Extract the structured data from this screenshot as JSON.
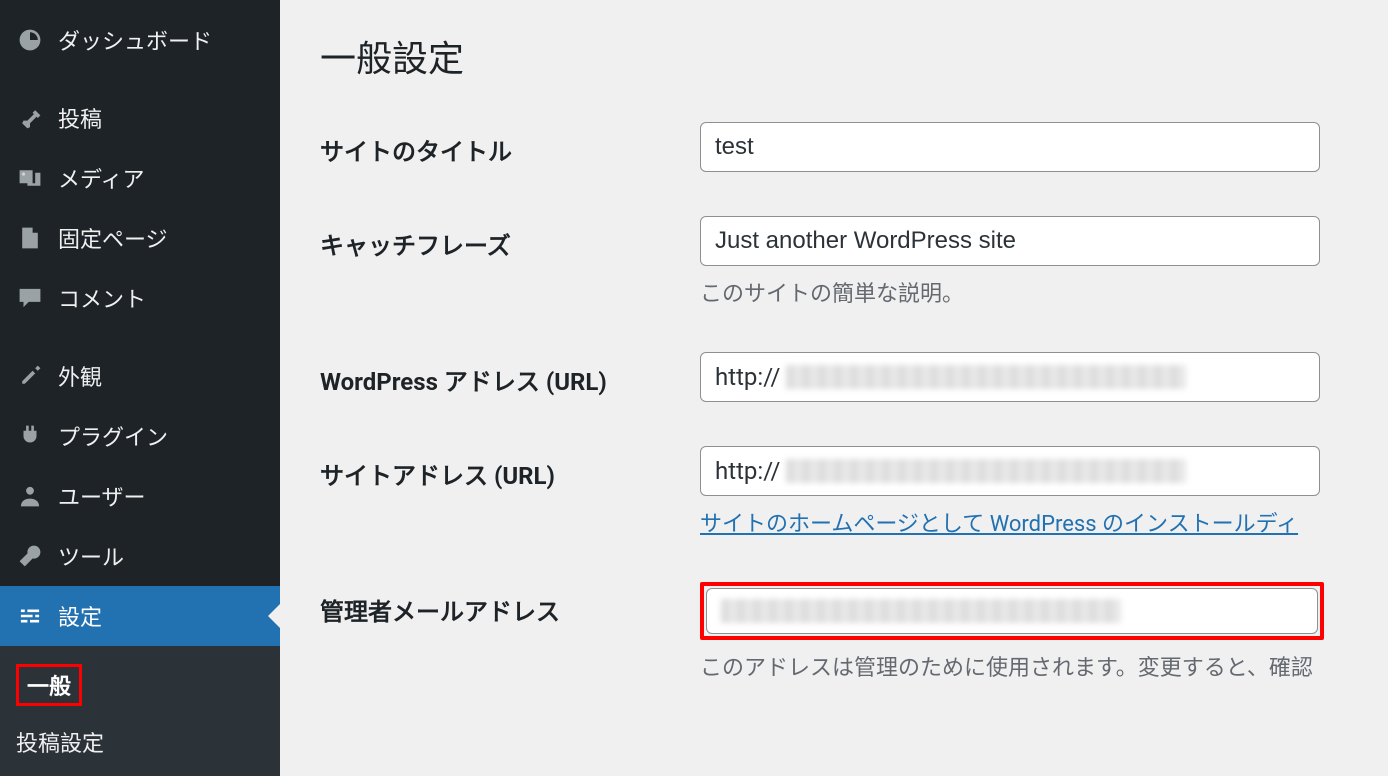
{
  "sidebar": {
    "items": [
      {
        "label": "ダッシュボード",
        "icon": "dashboard"
      },
      {
        "label": "投稿",
        "icon": "pin"
      },
      {
        "label": "メディア",
        "icon": "media"
      },
      {
        "label": "固定ページ",
        "icon": "page"
      },
      {
        "label": "コメント",
        "icon": "comment"
      },
      {
        "label": "外観",
        "icon": "appearance"
      },
      {
        "label": "プラグイン",
        "icon": "plugin"
      },
      {
        "label": "ユーザー",
        "icon": "user"
      },
      {
        "label": "ツール",
        "icon": "tool"
      },
      {
        "label": "設定",
        "icon": "settings"
      }
    ],
    "submenu": {
      "current": "一般",
      "next": "投稿設定"
    }
  },
  "page": {
    "title": "一般設定",
    "fields": {
      "site_title": {
        "label": "サイトのタイトル",
        "value": "test"
      },
      "tagline": {
        "label": "キャッチフレーズ",
        "value": "Just another WordPress site",
        "help": "このサイトの簡単な説明。"
      },
      "wp_url": {
        "label": "WordPress アドレス (URL)",
        "prefix": "http://"
      },
      "site_url": {
        "label": "サイトアドレス (URL)",
        "prefix": "http://",
        "link": "サイトのホームページとして WordPress のインストールディ"
      },
      "admin_email": {
        "label": "管理者メールアドレス",
        "help": "このアドレスは管理のために使用されます。変更すると、確認"
      }
    }
  }
}
